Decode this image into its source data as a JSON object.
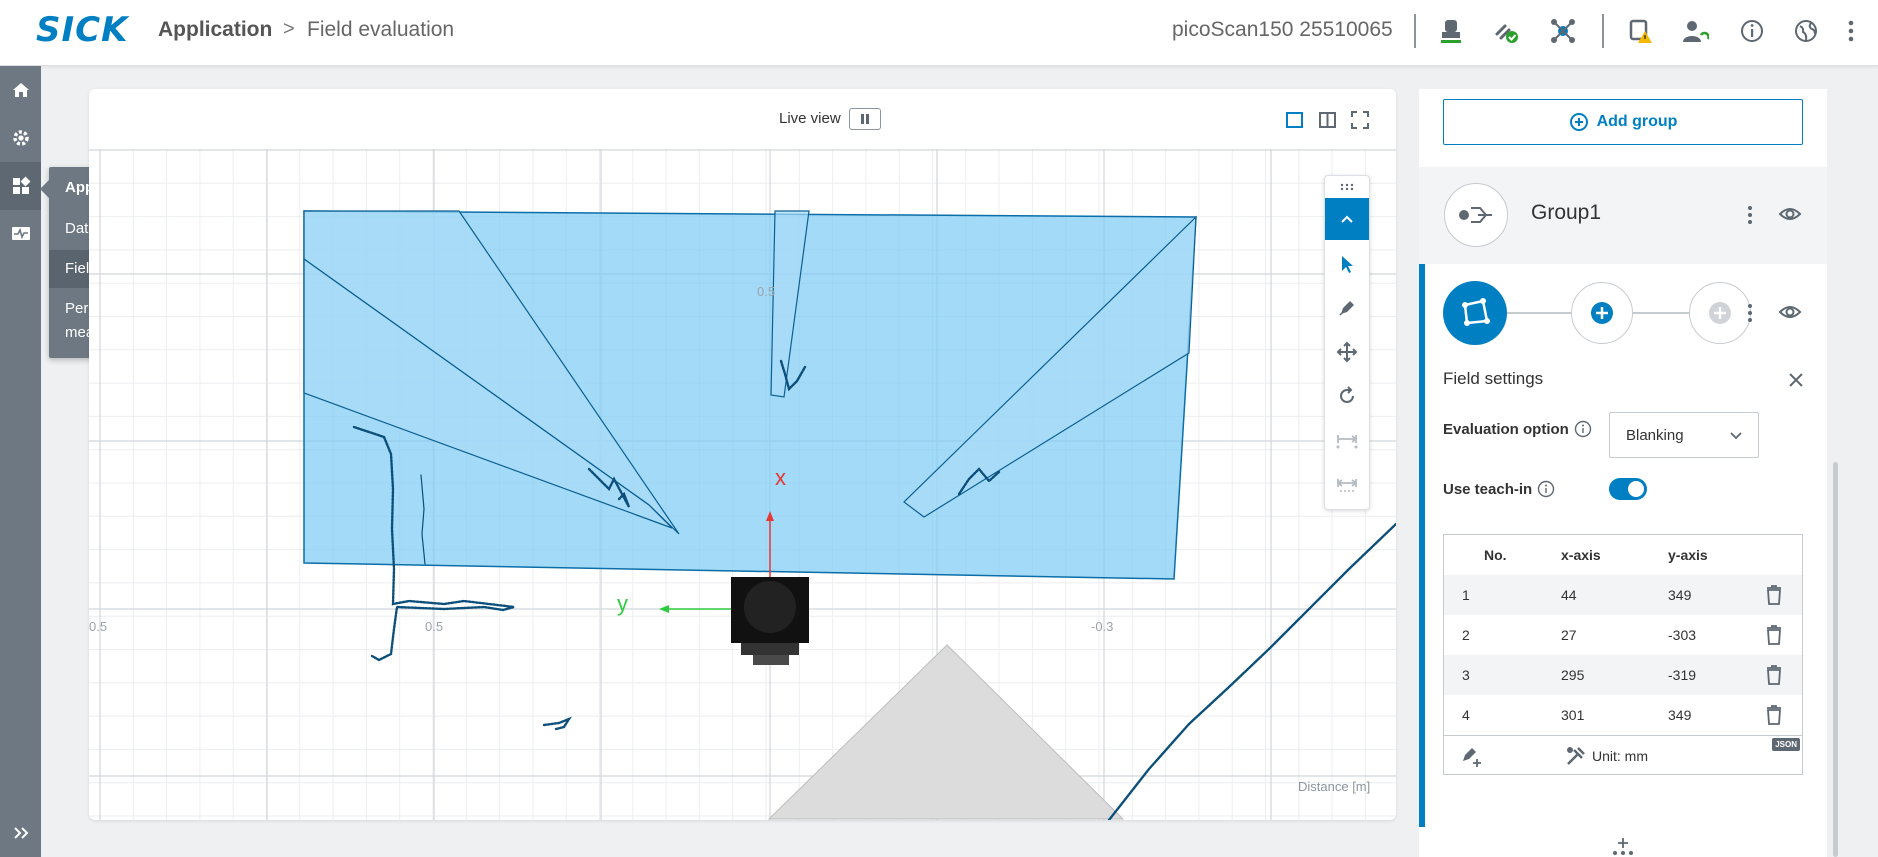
{
  "header": {
    "logo": "SICK",
    "breadcrumb_app": "Application",
    "breadcrumb_sep": ">",
    "breadcrumb_page": "Field evaluation",
    "device": "picoScan150 25510065"
  },
  "flyout": {
    "title": "Application",
    "items": [
      "Data output",
      "Field evaluation",
      "Perpendicular distance measurement"
    ],
    "selected": "Field evaluation"
  },
  "viewer": {
    "live_label": "Live view",
    "axis_x_label": "x",
    "axis_y_label": "y",
    "tick_labels": [
      "0.5",
      "0.5",
      "0.5",
      "-0.3"
    ],
    "distance_label": "Distance [m]",
    "colors": {
      "field_fill": "#7ccaf5",
      "scan_points": "#0b4f7a",
      "x_axis": "#e53935",
      "y_axis": "#2ecc40"
    }
  },
  "panel": {
    "add_group_label": "Add group",
    "group_name": "Group1",
    "field_settings_title": "Field settings",
    "evaluation_option_label": "Evaluation option",
    "evaluation_option_value": "Blanking",
    "teach_in_label": "Use teach-in",
    "teach_in_enabled": true,
    "table_headers": [
      "No.",
      "x-axis",
      "y-axis"
    ],
    "rows": [
      {
        "no": "1",
        "x": "44",
        "y": "349"
      },
      {
        "no": "2",
        "x": "27",
        "y": "-303"
      },
      {
        "no": "3",
        "x": "295",
        "y": "-319"
      },
      {
        "no": "4",
        "x": "301",
        "y": "349"
      }
    ],
    "unit_label": "Unit: mm",
    "json_badge": "JSON"
  },
  "accent": "#007fc3"
}
